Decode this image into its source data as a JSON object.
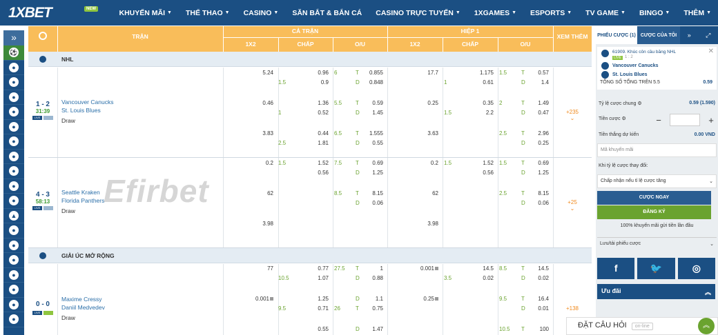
{
  "brand": {
    "logo": "1XBET",
    "new_badge": "NEW"
  },
  "nav": [
    "KHUYẾN MÃI",
    "THỂ THAO",
    "CASINO",
    "SĂN BẮT & BẮN CÁ",
    "CASINO TRỰC TUYẾN",
    "1XGAMES",
    "ESPORTS",
    "TV GAME",
    "BINGO",
    "THÊM"
  ],
  "table_header": {
    "match": "TRẬN",
    "full_match": "CẢ TRẬN",
    "half": "HIỆP 1",
    "more": "XEM THÊM",
    "col_1x2": "1X2",
    "col_handicap": "CHẤP",
    "col_ou": "O/U",
    "col_1x2_h": "1X2",
    "col_handicap_h": "CHẤP",
    "col_ou_h": "O/U"
  },
  "sections": [
    {
      "title": "NHL"
    },
    {
      "title": "GIẢI ÚC MỞ RỘNG"
    }
  ],
  "watermark": "Efirbet",
  "matches": [
    {
      "score": "1 - 2",
      "time": "31:39",
      "team1": "Vancouver Canucks",
      "team2": "St. Louis Blues",
      "draw": "Draw",
      "more": "+235",
      "odds": {
        "a": [
          "5.24",
          "0.96",
          "6",
          "T",
          "0.855",
          "17.7",
          "1.175",
          "1.5",
          "T",
          "0.57"
        ],
        "b": [
          "1.5",
          "0.9",
          "D",
          "0.848",
          "1",
          "0.61",
          "D",
          "1.4"
        ],
        "c": [
          "0.46",
          "1.36",
          "5.5",
          "T",
          "0.59",
          "0.25",
          "0.35",
          "2",
          "T",
          "1.49"
        ],
        "d": [
          "1",
          "0.52",
          "D",
          "1.45",
          "1.5",
          "2.2",
          "D",
          "0.47"
        ],
        "e": [
          "3.83",
          "0.44",
          "6.5",
          "T",
          "1.555",
          "3.63",
          "2.5",
          "T",
          "2.96"
        ],
        "f": [
          "2.5",
          "1.81",
          "D",
          "0.55",
          "D",
          "0.25"
        ]
      }
    },
    {
      "score": "4 - 3",
      "time": "58:13",
      "team1": "Seattle Kraken",
      "team2": "Florida Panthers",
      "draw": "Draw",
      "more": "+25",
      "odds": {
        "a": [
          "0.2",
          "1.5",
          "1.52",
          "7.5",
          "T",
          "0.69",
          "0.2",
          "1.5",
          "1.52",
          "1.5",
          "T",
          "0.69"
        ],
        "b": [
          "0.56",
          "D",
          "1.25",
          "0.56",
          "D",
          "1.25"
        ],
        "c": [
          "62",
          "8.5",
          "T",
          "8.15",
          "62",
          "2.5",
          "T",
          "8.15"
        ],
        "d": [
          "D",
          "0.06",
          "D",
          "0.06"
        ],
        "e": [
          "3.98",
          "3.98"
        ]
      }
    },
    {
      "score": "0 - 0",
      "time": "",
      "team1": "Maxime Cressy",
      "team2": "Daniil Medvedev",
      "draw": "Draw",
      "more": "+138",
      "odds": {
        "a": [
          "77",
          "0.77",
          "27.5",
          "T",
          "1",
          "0.001",
          "14.5",
          "8.5",
          "T",
          "14.5"
        ],
        "b": [
          "10.5",
          "1.07",
          "D",
          "0.88",
          "3.5",
          "0.02",
          "D",
          "0.02"
        ],
        "c": [
          "0.001",
          "1.25",
          "D",
          "1.1",
          "0.25",
          "9.5",
          "T",
          "16.4"
        ],
        "d": [
          "9.5",
          "0.71",
          "26",
          "T",
          "0.75",
          "D",
          "0.01"
        ],
        "e": [
          "0.55",
          "D",
          "1.47",
          "10.5",
          "T",
          "100"
        ]
      }
    }
  ],
  "betslip": {
    "tab1": "PHIẾU CƯỢC (1)",
    "tab2": "CƯỢC CỦA TÔI",
    "event": "61909. Khúc côn cầu băng NHL",
    "live": "LIVE",
    "score": "1 : 2",
    "team1": "Vancouver Canucks",
    "team2": "St. Louis Blues",
    "bet_label": "TỔNG SỐ TỔNG TRÊN 5.5",
    "bet_odd": "0.59",
    "total_rate_label": "Tỷ lệ cược chung",
    "total_rate": "0.59 (1.590)",
    "stake_label": "Tiền cược",
    "win_label": "Tiền thắng dự kiến",
    "win_value": "0.00 VND",
    "promo_placeholder": "Mã khuyến mãi",
    "change_label": "Khi tỷ lệ cược thay đổi:",
    "change_select": "Chấp nhận nếu tỉ lệ cược tăng",
    "btn_bet": "CƯỢC NGAY",
    "btn_register": "ĐĂNG KÝ",
    "promo_text": "100% khuyến mãi gửi tiền lần đầu",
    "save_label": "Lưu/tải phiếu cược"
  },
  "social": [
    "f",
    "t",
    "ig"
  ],
  "offers": "Ưu đãi",
  "ask": {
    "label": "ĐẶT CÂU HỎI",
    "status": "on-line"
  }
}
